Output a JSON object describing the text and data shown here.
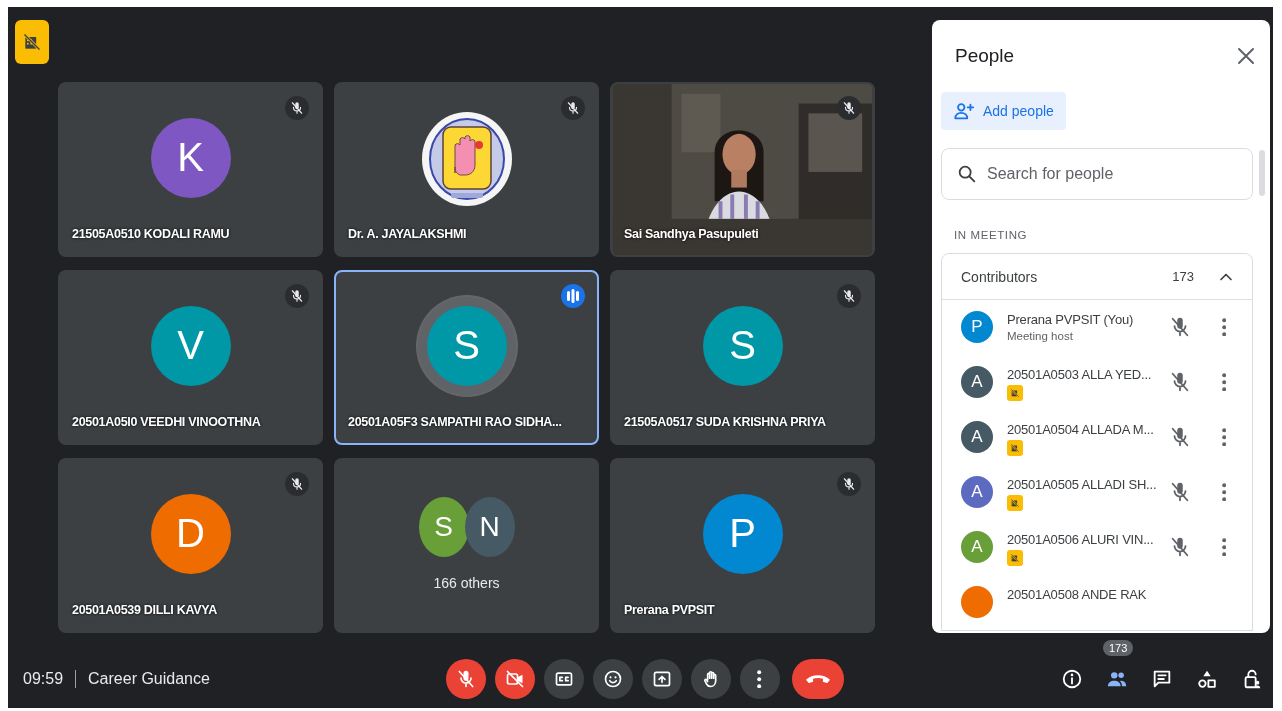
{
  "tiles": [
    {
      "kind": "avatar",
      "name": "21505A0510 KODALI RAMU",
      "initial": "K",
      "color": "#7e57c2",
      "muted": true,
      "speaking": false
    },
    {
      "kind": "logo",
      "name": "Dr. A. JAYALAKSHMI",
      "muted": true,
      "speaking": false
    },
    {
      "kind": "video",
      "name": "Sai Sandhya Pasupuleti",
      "muted": true,
      "speaking": false
    },
    {
      "kind": "avatar",
      "name": "20501A05I0 VEEDHI VINOOTHNA",
      "initial": "V",
      "color": "#0097a7",
      "muted": true,
      "speaking": false
    },
    {
      "kind": "avatar",
      "name": "20501A05F3 SAMPATHI RAO SIDHA...",
      "initial": "S",
      "color": "#0097a7",
      "muted": false,
      "speaking": true
    },
    {
      "kind": "avatar",
      "name": "21505A0517 SUDA KRISHNA PRIYA",
      "initial": "S",
      "color": "#0097a7",
      "muted": true,
      "speaking": false
    },
    {
      "kind": "avatar",
      "name": "20501A0539 DILLI KAVYA",
      "initial": "D",
      "color": "#ef6c00",
      "muted": true,
      "speaking": false
    },
    {
      "kind": "group",
      "label": "166 others",
      "avatars": [
        {
          "initial": "S",
          "color": "#689f38"
        },
        {
          "initial": "N",
          "color": "#455a64"
        }
      ]
    },
    {
      "kind": "avatar",
      "name": "Prerana PVPSIT",
      "initial": "P",
      "color": "#0288d1",
      "muted": true,
      "speaking": false
    }
  ],
  "people_panel": {
    "title": "People",
    "add_button": "Add people",
    "search": {
      "placeholder": "Search for people"
    },
    "section": "IN MEETING",
    "group": {
      "label": "Contributors",
      "count": "173",
      "expanded": true
    },
    "participants": [
      {
        "name": "Prerana PVPSIT (You)",
        "role": "Meeting host",
        "initial": "P",
        "color": "#0288d1",
        "camera_off": false,
        "muted": true
      },
      {
        "name": "20501A0503 ALLA YED...",
        "initial": "A",
        "color": "#455a64",
        "camera_off": true,
        "muted": true
      },
      {
        "name": "20501A0504 ALLADA M...",
        "initial": "A",
        "color": "#455a64",
        "camera_off": true,
        "muted": true
      },
      {
        "name": "20501A0505 ALLADI SH...",
        "initial": "A",
        "color": "#5c6bc0",
        "camera_off": true,
        "muted": true
      },
      {
        "name": "20501A0506 ALURI VIN...",
        "initial": "A",
        "color": "#689f38",
        "camera_off": true,
        "muted": true
      },
      {
        "name": "20501A0508 ANDE RAK",
        "color": "#ef6c00"
      }
    ]
  },
  "bottom_bar": {
    "time": "09:59",
    "title": "Career Guidance",
    "controls": [
      {
        "kind": "mic",
        "off": true
      },
      {
        "kind": "camera",
        "off": true
      },
      {
        "kind": "captions"
      },
      {
        "kind": "emoji"
      },
      {
        "kind": "present"
      },
      {
        "kind": "hand"
      },
      {
        "kind": "more"
      },
      {
        "kind": "end_call"
      }
    ],
    "side_buttons": [
      {
        "kind": "info",
        "selected": false
      },
      {
        "kind": "people",
        "selected": true,
        "badge": "173"
      },
      {
        "kind": "chat",
        "selected": false
      },
      {
        "kind": "activities",
        "selected": false
      },
      {
        "kind": "host_controls",
        "selected": false
      }
    ]
  }
}
